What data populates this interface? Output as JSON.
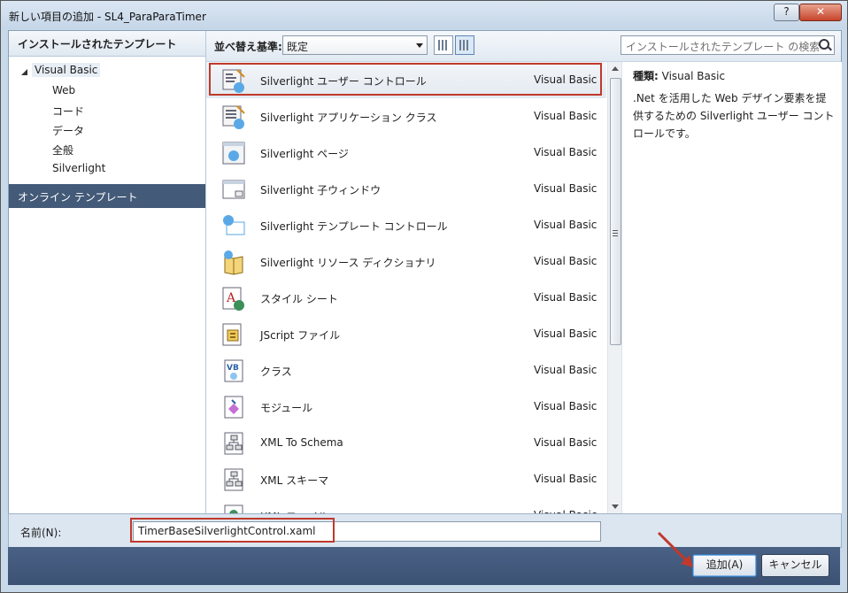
{
  "window": {
    "title": "新しい項目の追加 - SL4_ParaParaTimer",
    "help_label": "?",
    "close_label": "✕"
  },
  "left": {
    "installed_header": "インストールされたテンプレート",
    "tree": [
      {
        "label": "Visual Basic"
      },
      {
        "label": "Web"
      },
      {
        "label": "コード"
      },
      {
        "label": "データ"
      },
      {
        "label": "全般"
      },
      {
        "label": "Silverlight"
      }
    ],
    "online_label": "オンライン テンプレート"
  },
  "toolbar": {
    "sort_label": "並べ替え基準:",
    "sort_value": "既定",
    "search_placeholder": "インストールされたテンプレート の検索"
  },
  "templates": [
    {
      "name": "Silverlight ユーザー コントロール",
      "lang": "Visual Basic",
      "icon": "user-control-icon"
    },
    {
      "name": "Silverlight アプリケーション クラス",
      "lang": "Visual Basic",
      "icon": "app-class-icon"
    },
    {
      "name": "Silverlight ページ",
      "lang": "Visual Basic",
      "icon": "page-icon"
    },
    {
      "name": "Silverlight 子ウィンドウ",
      "lang": "Visual Basic",
      "icon": "child-window-icon"
    },
    {
      "name": "Silverlight テンプレート コントロール",
      "lang": "Visual Basic",
      "icon": "template-control-icon"
    },
    {
      "name": "Silverlight リソース ディクショナリ",
      "lang": "Visual Basic",
      "icon": "resource-dictionary-icon"
    },
    {
      "name": "スタイル シート",
      "lang": "Visual Basic",
      "icon": "style-sheet-icon"
    },
    {
      "name": "JScript ファイル",
      "lang": "Visual Basic",
      "icon": "jscript-icon"
    },
    {
      "name": "クラス",
      "lang": "Visual Basic",
      "icon": "class-icon"
    },
    {
      "name": "モジュール",
      "lang": "Visual Basic",
      "icon": "module-icon"
    },
    {
      "name": "XML To Schema",
      "lang": "Visual Basic",
      "icon": "xml-schema-icon"
    },
    {
      "name": "XML スキーマ",
      "lang": "Visual Basic",
      "icon": "xml-schema-icon"
    },
    {
      "name": "XML ファイル",
      "lang": "Visual Basic",
      "icon": "xml-file-icon"
    }
  ],
  "details": {
    "kind_label": "種類:",
    "kind_value": "Visual Basic",
    "description": ".Net を活用した Web デザイン要素を提供するための Silverlight ユーザー コントロールです。"
  },
  "name_field": {
    "label": "名前(N):",
    "value": "TimerBaseSilverlightControl.xaml"
  },
  "buttons": {
    "add": "追加(A)",
    "cancel": "キャンセル"
  },
  "colors": {
    "highlight": "#c0392b",
    "online_bg": "#435a78",
    "bottom_bg": "#3b5274"
  }
}
